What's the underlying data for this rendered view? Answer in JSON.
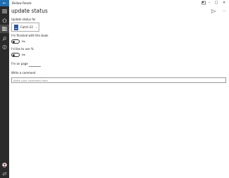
{
  "window": {
    "app_title": "Bellow Reads",
    "minimize_glyph": "–",
    "maximize_glyph": "□",
    "close_glyph": "✕"
  },
  "header": {
    "title": "update status",
    "more_glyph": "···"
  },
  "form": {
    "update_for_label": "Update status for",
    "book_name": "Catch-22",
    "finished_label": "I'm finished with this book",
    "finished_state": "No",
    "like_label": "I'd like to use %",
    "like_state": "No",
    "page_label": "I'm on page",
    "comment_label": "Write a comment",
    "comment_placeholder": "Write your comment here"
  },
  "colors": {
    "accent": "#1f6fb3",
    "nav_bg": "#2b2b2b"
  },
  "icons": {
    "back": "back-arrow-icon",
    "nav": [
      "hamburger-menu-icon",
      "home-icon",
      "library-icon",
      "search-icon",
      "info-icon",
      "avatar-icon",
      "share-icon"
    ],
    "header": [
      "send-icon",
      "more-icon"
    ]
  }
}
